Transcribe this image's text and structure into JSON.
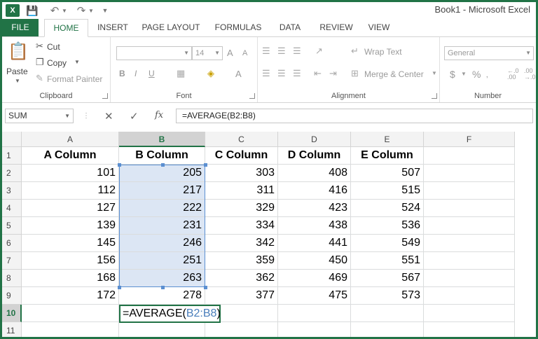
{
  "titlebar": {
    "app_icon_label": "X",
    "title": "Book1 - Microsoft Excel"
  },
  "tabs": [
    {
      "label": "FILE"
    },
    {
      "label": "HOME"
    },
    {
      "label": "INSERT"
    },
    {
      "label": "PAGE LAYOUT"
    },
    {
      "label": "FORMULAS"
    },
    {
      "label": "DATA"
    },
    {
      "label": "REVIEW"
    },
    {
      "label": "VIEW"
    }
  ],
  "ribbon": {
    "clipboard": {
      "paste": "Paste",
      "cut": "Cut",
      "copy": "Copy",
      "format_painter": "Format Painter",
      "label": "Clipboard"
    },
    "font": {
      "font_name": "",
      "font_size": "14",
      "bold": "B",
      "italic": "I",
      "underline": "U",
      "grow": "A",
      "shrink": "A",
      "font_color": "A",
      "label": "Font"
    },
    "alignment": {
      "wrap_text": "Wrap Text",
      "merge_center": "Merge & Center",
      "label": "Alignment"
    },
    "number": {
      "format": "General",
      "currency": "$",
      "percent": "%",
      "label": "Number"
    }
  },
  "formula_bar": {
    "name_box": "SUM",
    "cancel": "✕",
    "enter": "✓",
    "fx": "fx",
    "formula": "=AVERAGE(B2:B8)"
  },
  "columns": [
    "A",
    "B",
    "C",
    "D",
    "E",
    "F"
  ],
  "rows": [
    "1",
    "2",
    "3",
    "4",
    "5",
    "6",
    "7",
    "8",
    "9",
    "10",
    "11"
  ],
  "sheet": {
    "headers": [
      "A Column",
      "B Column",
      "C Column",
      "D Column",
      "E Column"
    ],
    "data": [
      [
        "101",
        "205",
        "303",
        "408",
        "507"
      ],
      [
        "112",
        "217",
        "311",
        "416",
        "515"
      ],
      [
        "127",
        "222",
        "329",
        "423",
        "524"
      ],
      [
        "139",
        "231",
        "334",
        "438",
        "536"
      ],
      [
        "145",
        "246",
        "342",
        "441",
        "549"
      ],
      [
        "156",
        "251",
        "359",
        "450",
        "551"
      ],
      [
        "168",
        "263",
        "362",
        "469",
        "567"
      ],
      [
        "172",
        "278",
        "377",
        "475",
        "573"
      ]
    ],
    "edit_cell": {
      "prefix": "=AVERAGE(",
      "range": "B2:B8",
      "suffix": ")"
    }
  },
  "colors": {
    "excel_green": "#217346",
    "selection_fill": "#dce6f4",
    "selection_border": "#5b8fd1"
  }
}
